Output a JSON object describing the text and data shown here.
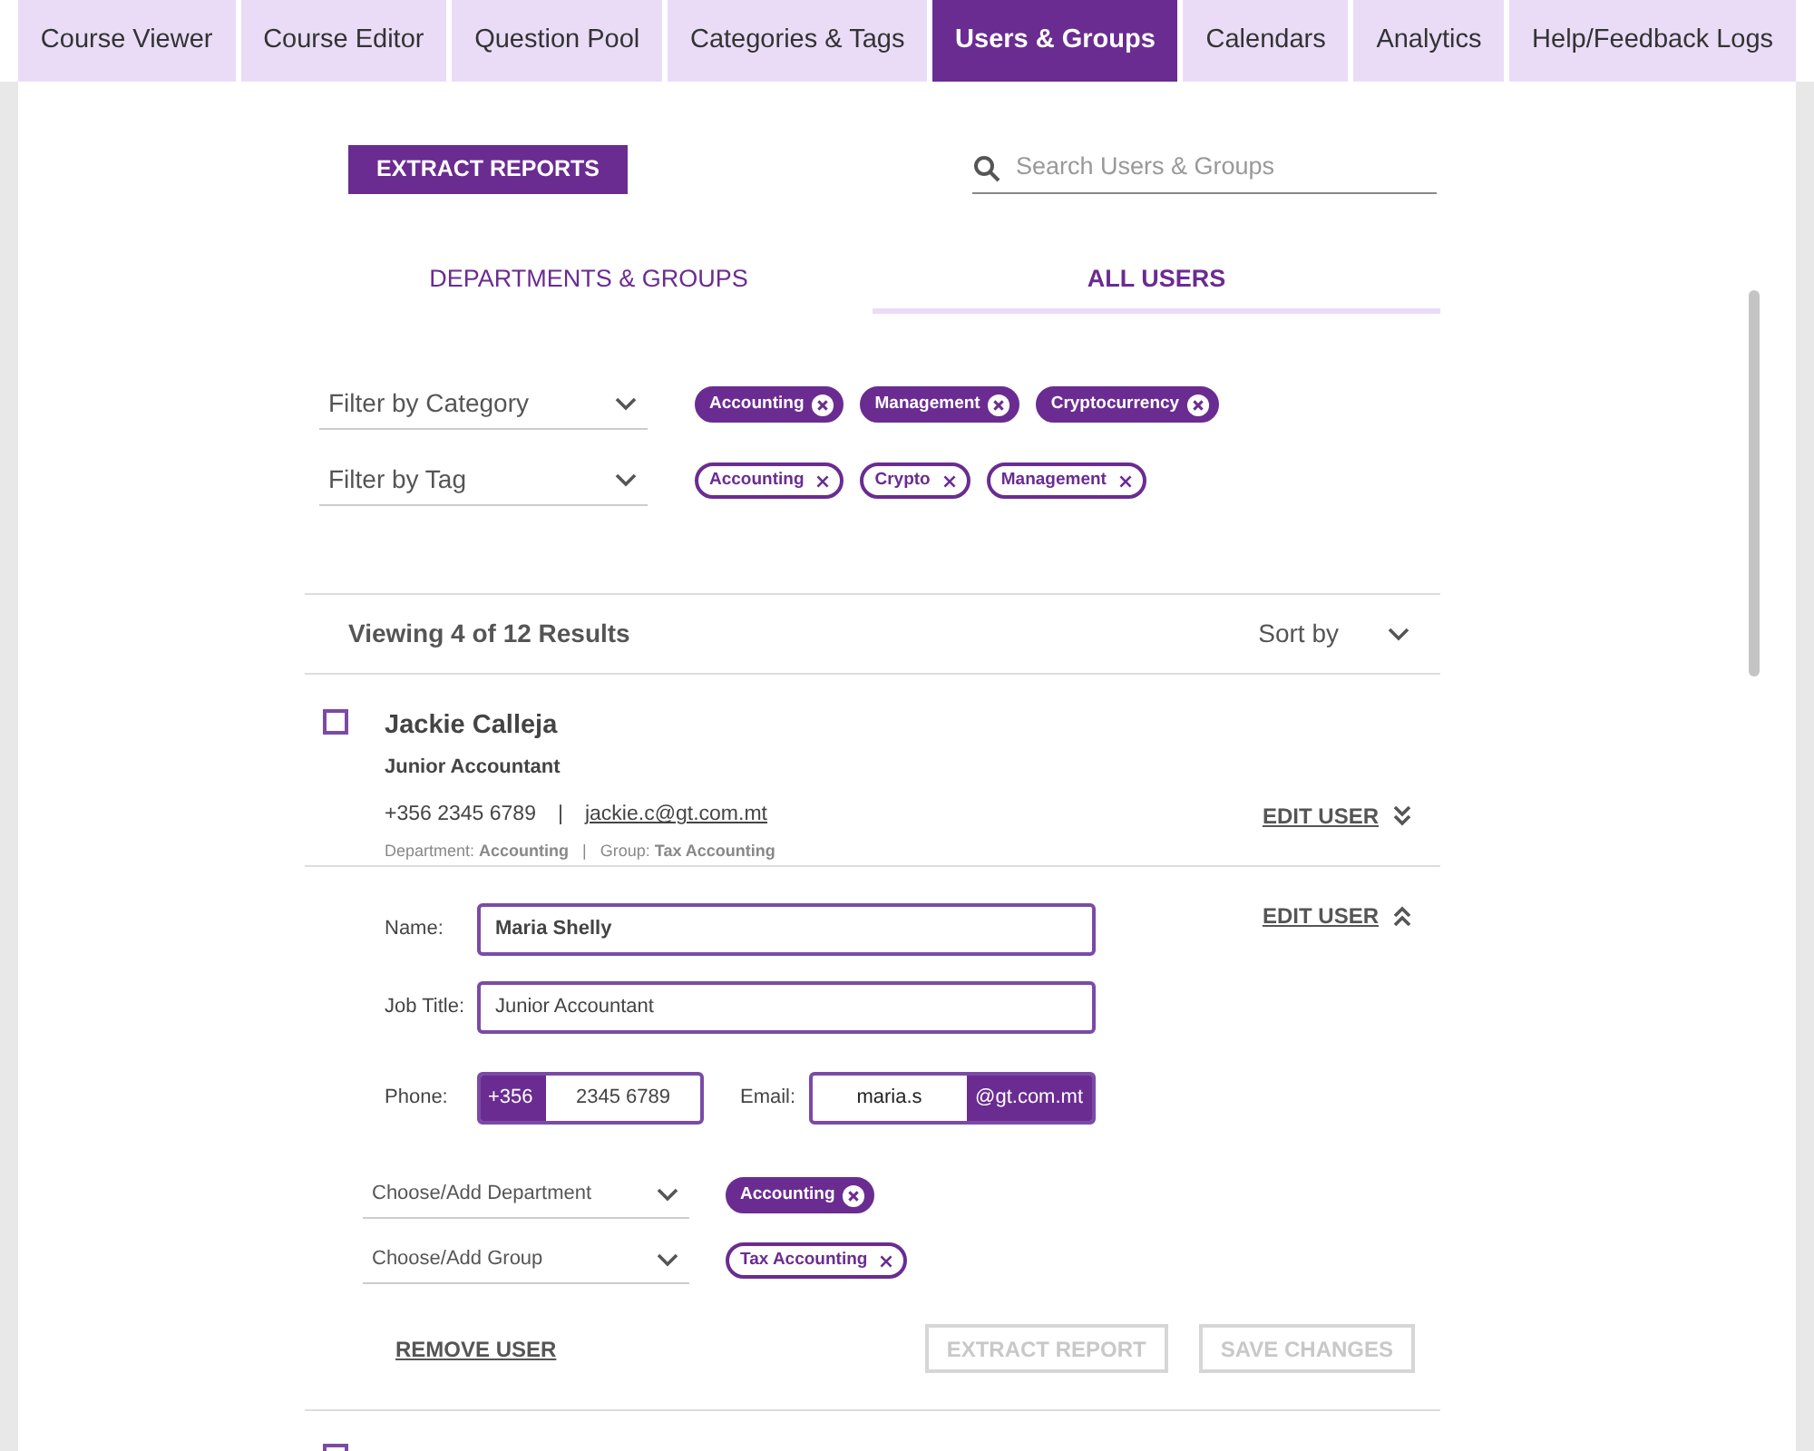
{
  "tabs": [
    {
      "label": "Course Viewer",
      "selected": false
    },
    {
      "label": "Course Editor",
      "selected": false
    },
    {
      "label": "Question Pool",
      "selected": false
    },
    {
      "label": "Categories & Tags",
      "selected": false
    },
    {
      "label": "Users & Groups",
      "selected": true
    },
    {
      "label": "Calendars",
      "selected": false
    },
    {
      "label": "Analytics",
      "selected": false
    },
    {
      "label": "Help/Feedback Logs",
      "selected": false
    }
  ],
  "extract_button": "EXTRACT REPORTS",
  "search": {
    "placeholder": "Search Users & Groups"
  },
  "subtabs": [
    {
      "label": "DEPARTMENTS & GROUPS",
      "selected": false
    },
    {
      "label": "ALL USERS",
      "selected": true
    }
  ],
  "filters": [
    {
      "label": "Filter by Category",
      "chips": [
        {
          "label": "Accounting",
          "kind": "filled"
        },
        {
          "label": "Management",
          "kind": "filled"
        },
        {
          "label": "Cryptocurrency",
          "kind": "filled"
        }
      ]
    },
    {
      "label": "Filter by Tag",
      "chips": [
        {
          "label": "Accounting",
          "kind": "outline"
        },
        {
          "label": "Crypto",
          "kind": "outline"
        },
        {
          "label": "Management",
          "kind": "outline"
        }
      ]
    }
  ],
  "results": {
    "summary": "Viewing 4 of 12 Results",
    "sort_label": "Sort by"
  },
  "user": {
    "checked": false,
    "name": "Jackie Calleja",
    "job_title": "Junior Accountant",
    "phone": "+356 2345 6789",
    "separator": "|",
    "email": "jackie.c@gt.com.mt",
    "meta": "Department: **Accounting**   |   Group: **Tax Accounting**",
    "edit": "EDIT USER",
    "expanded": false
  },
  "edit_form": {
    "edit": "EDIT USER",
    "expanded": true,
    "name_label": "Name:",
    "name_value": "Maria Shelly",
    "job_label": "Job Title:",
    "job_value": "Junior Accountant",
    "phone_label": "Phone:",
    "phone_prefix": "+356",
    "phone_value": "2345 6789",
    "email_label": "Email:",
    "email_value": "maria.s",
    "email_suffix": "@gt.com.mt",
    "selects": [
      {
        "placeholder": "Choose/Add Department",
        "chips": [
          {
            "label": "Accounting",
            "kind": "filled"
          }
        ]
      },
      {
        "placeholder": "Choose/Add Group",
        "chips": [
          {
            "label": "Tax Accounting",
            "kind": "outline"
          }
        ]
      }
    ],
    "remove": "REMOVE USER",
    "buttons": [
      {
        "label": "EXTRACT REPORT",
        "disabled": true
      },
      {
        "label": "SAVE CHANGES",
        "disabled": true
      }
    ]
  },
  "next_user": {
    "checked": false
  }
}
